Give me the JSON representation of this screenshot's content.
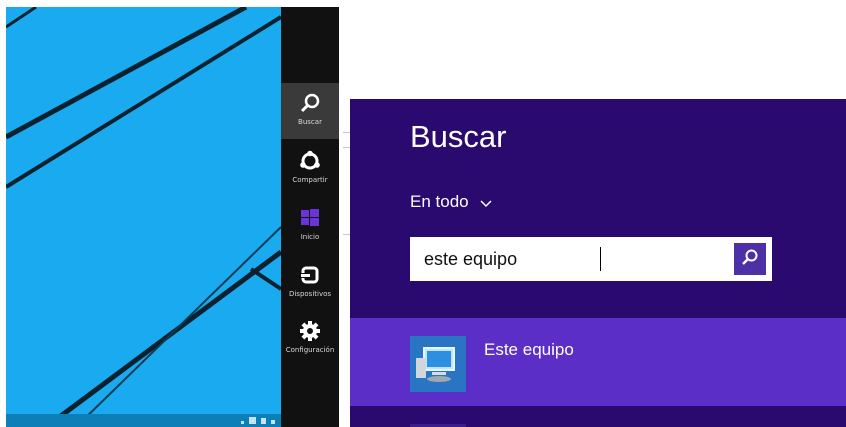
{
  "charms": [
    {
      "label": "Buscar",
      "icon": "search-icon",
      "active": true
    },
    {
      "label": "Compartir",
      "icon": "share-icon",
      "active": false
    },
    {
      "label": "Inicio",
      "icon": "windows-logo-icon",
      "active": false
    },
    {
      "label": "Dispositivos",
      "icon": "devices-icon",
      "active": false
    },
    {
      "label": "Configuración",
      "icon": "gear-icon",
      "active": false
    }
  ],
  "search": {
    "title": "Buscar",
    "scope_label": "En todo",
    "query": "este equipo",
    "results": [
      {
        "label": "Este equipo",
        "icon": "computer-icon"
      }
    ]
  },
  "colors": {
    "desktop": "#19aaf0",
    "charms_bar": "#111111",
    "panel": "#2a0a6e",
    "result_highlight": "#5b2ec7",
    "search_button": "#4d2fa6"
  }
}
